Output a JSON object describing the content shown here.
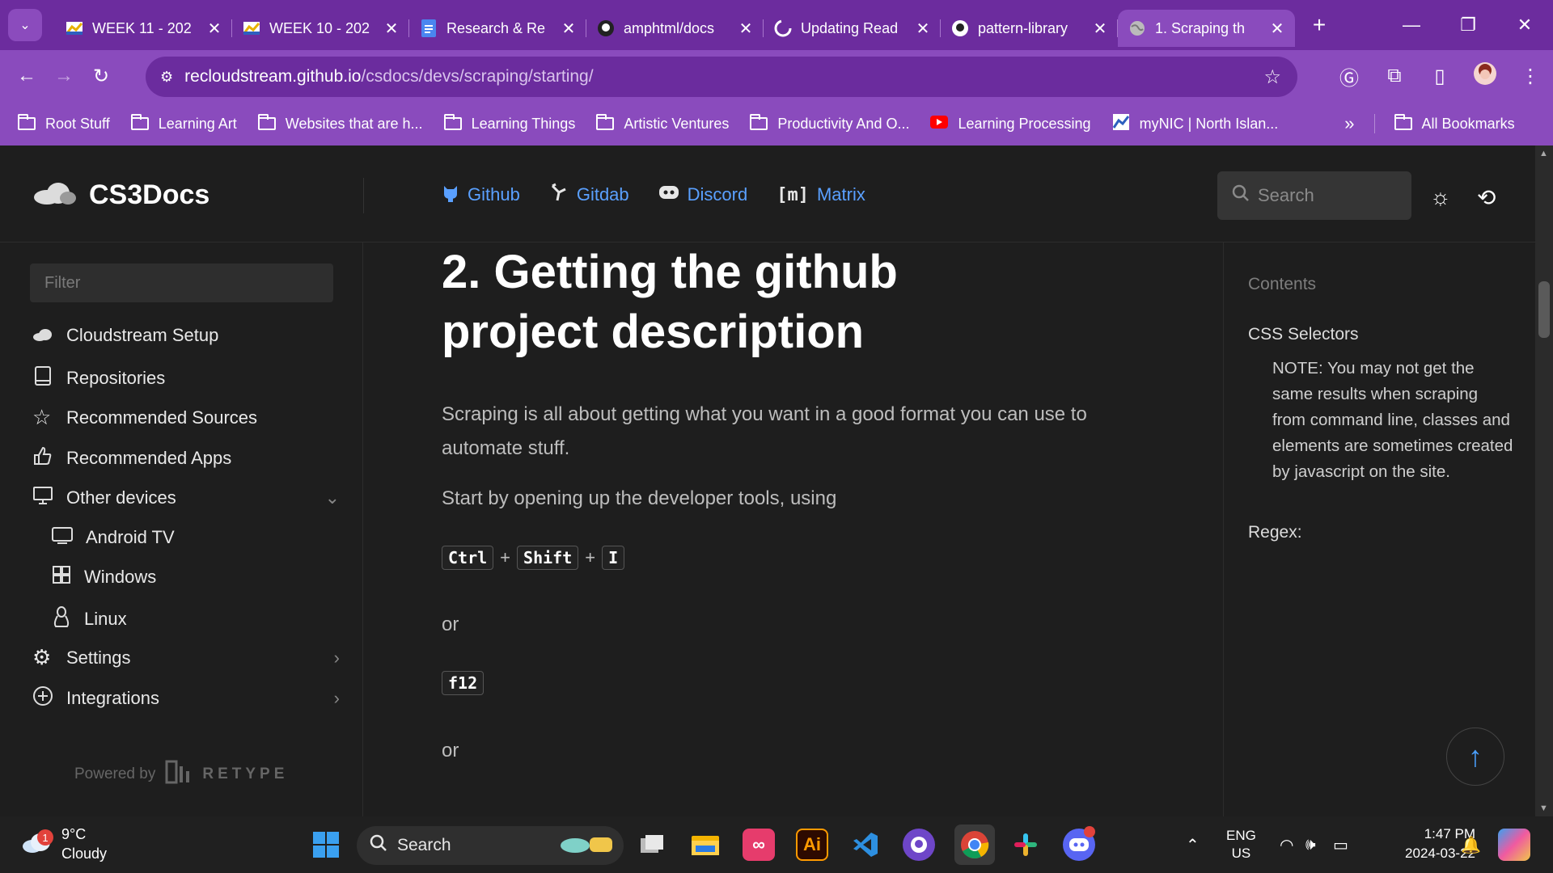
{
  "browser": {
    "tabs": [
      {
        "title": "WEEK 11 - 202",
        "icon": "chart-icon"
      },
      {
        "title": "WEEK 10 - 202",
        "icon": "chart-icon"
      },
      {
        "title": "Research & Re",
        "icon": "docs-icon"
      },
      {
        "title": "amphtml/docs",
        "icon": "github-icon"
      },
      {
        "title": "Updating Read",
        "icon": "github-loading-icon"
      },
      {
        "title": "pattern-library",
        "icon": "github-icon"
      },
      {
        "title": "1. Scraping th",
        "icon": "globe-icon",
        "active": true
      }
    ],
    "url_host": "recloudstream.github.io",
    "url_path": "/csdocs/devs/scraping/starting/",
    "bookmarks": [
      "Root Stuff",
      "Learning Art",
      "Websites that are h...",
      "Learning Things",
      "Artistic Ventures",
      "Productivity And O...",
      "Learning Processing",
      "myNIC | North Islan..."
    ],
    "all_bookmarks": "All Bookmarks"
  },
  "site": {
    "brand": "CS3Docs",
    "links": [
      "Github",
      "Gitdab",
      "Discord",
      "Matrix"
    ],
    "search_placeholder": "Search",
    "filter_placeholder": "Filter",
    "nav": [
      {
        "label": "Cloudstream Setup",
        "icon": "cloud-icon"
      },
      {
        "label": "Repositories",
        "icon": "book-icon"
      },
      {
        "label": "Recommended Sources",
        "icon": "star-icon"
      },
      {
        "label": "Recommended Apps",
        "icon": "thumbs-up-icon"
      },
      {
        "label": "Other devices",
        "icon": "monitor-icon",
        "expanded": true
      },
      {
        "label": "Android TV",
        "icon": "tv-icon",
        "sub": true
      },
      {
        "label": "Windows",
        "icon": "windows-icon",
        "sub": true
      },
      {
        "label": "Linux",
        "icon": "linux-icon",
        "sub": true
      },
      {
        "label": "Settings",
        "icon": "gear-icon"
      },
      {
        "label": "Integrations",
        "icon": "plus-circle-icon"
      }
    ],
    "powered_by": "Powered by",
    "powered_brand": "RETYPE"
  },
  "article": {
    "heading_line1": "2. Getting the github",
    "heading_line2": "project description",
    "p1": "Scraping is all about getting what you want in a good format you can use to automate stuff.",
    "p2": "Start by opening up the developer tools, using",
    "keys": [
      "Ctrl",
      "Shift",
      "I"
    ],
    "plus": "+",
    "or1": "or",
    "key_f12": "f12",
    "or2": "or"
  },
  "toc": {
    "heading": "Contents",
    "item1": "CSS Selectors",
    "note": "NOTE: You may not get the same results when scraping from command line, classes and elements are sometimes created by javascript on the site.",
    "item2": "Regex:"
  },
  "taskbar": {
    "weather_temp": "9°C",
    "weather_desc": "Cloudy",
    "weather_badge": "1",
    "search_label": "Search",
    "lang1": "ENG",
    "lang2": "US",
    "time": "1:47 PM",
    "date": "2024-03-22"
  },
  "colors": {
    "chrome": "#8a4bbd",
    "tabstrip": "#6c2c9e",
    "link": "#5aa0ff"
  }
}
